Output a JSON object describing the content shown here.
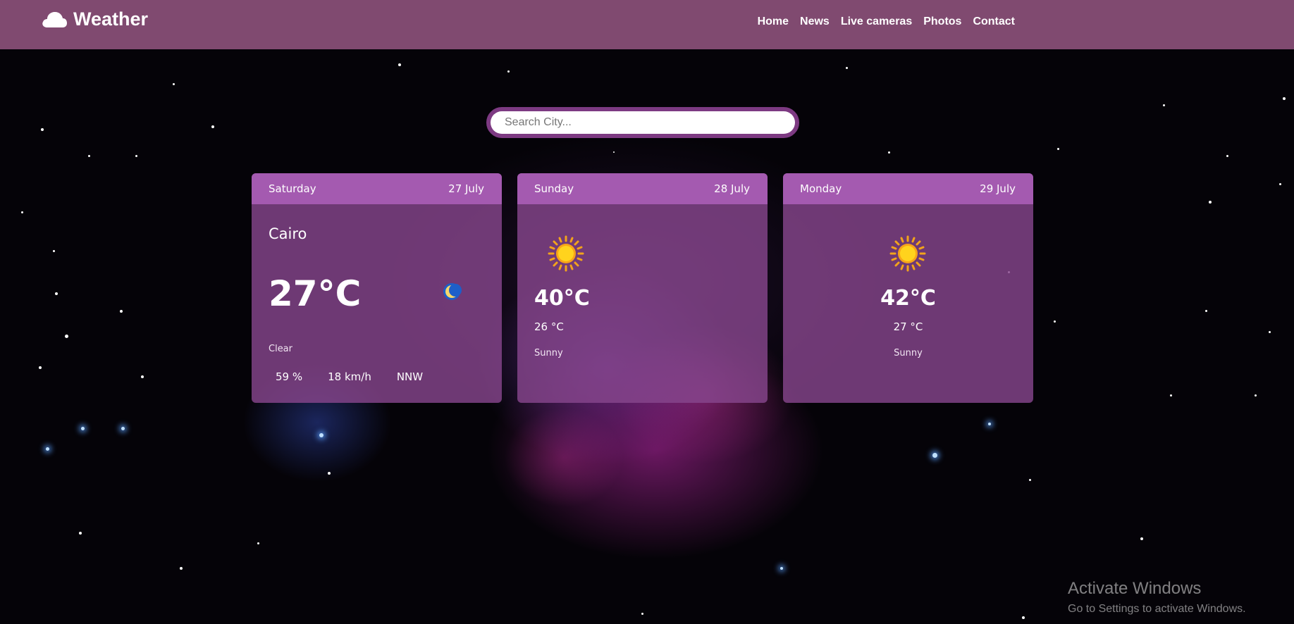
{
  "brand": {
    "title": "Weather",
    "icon": "cloud-icon"
  },
  "nav": [
    "Home",
    "News",
    "Live cameras",
    "Photos",
    "Contact"
  ],
  "search": {
    "placeholder": "Search City...",
    "glyph": ""
  },
  "today": {
    "day": "Saturday",
    "date": "27 July",
    "city": "Cairo",
    "temp": "27°C",
    "condition": "Clear",
    "icon": "moon-icon",
    "humidity": "59 %",
    "wind": "18 km/h",
    "direction": "NNW",
    "glyph": ""
  },
  "forecast": [
    {
      "day": "Sunday",
      "date": "28 July",
      "max": "40°C",
      "min": "26 °C",
      "condition": "Sunny",
      "icon": "sun-icon"
    },
    {
      "day": "Monday",
      "date": "29 July",
      "max": "42°C",
      "min": "27 °C",
      "condition": "Sunny",
      "icon": "sun-icon"
    }
  ],
  "watermark": {
    "title": "Activate Windows",
    "subtitle": "Go to Settings to activate Windows."
  },
  "colors": {
    "navbar": "#854d75",
    "card_header": "#a45ab0",
    "card_body": "#86468c",
    "search_border": "#7d3a82"
  }
}
